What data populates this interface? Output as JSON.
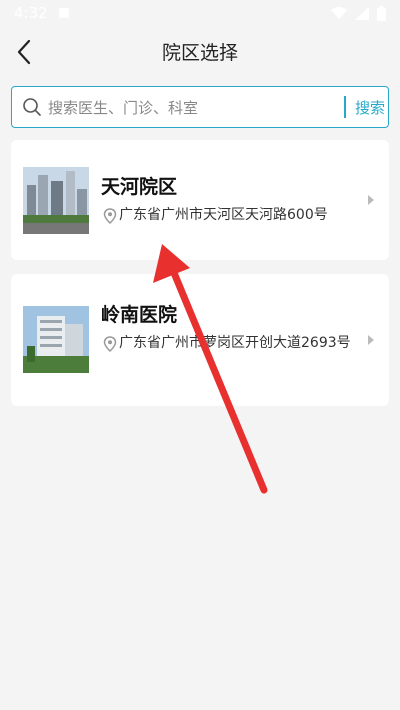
{
  "status": {
    "time": "4:32"
  },
  "header": {
    "title": "院区选择"
  },
  "search": {
    "placeholder": "搜索医生、门诊、科室",
    "button_label": "搜索"
  },
  "campuses": [
    {
      "name": "天河院区",
      "address": "广东省广州市天河区天河路600号"
    },
    {
      "name": "岭南医院",
      "address": "广东省广州市萝岗区开创大道2693号"
    }
  ],
  "colors": {
    "accent": "#26a9c8",
    "arrow": "#e8312f"
  }
}
